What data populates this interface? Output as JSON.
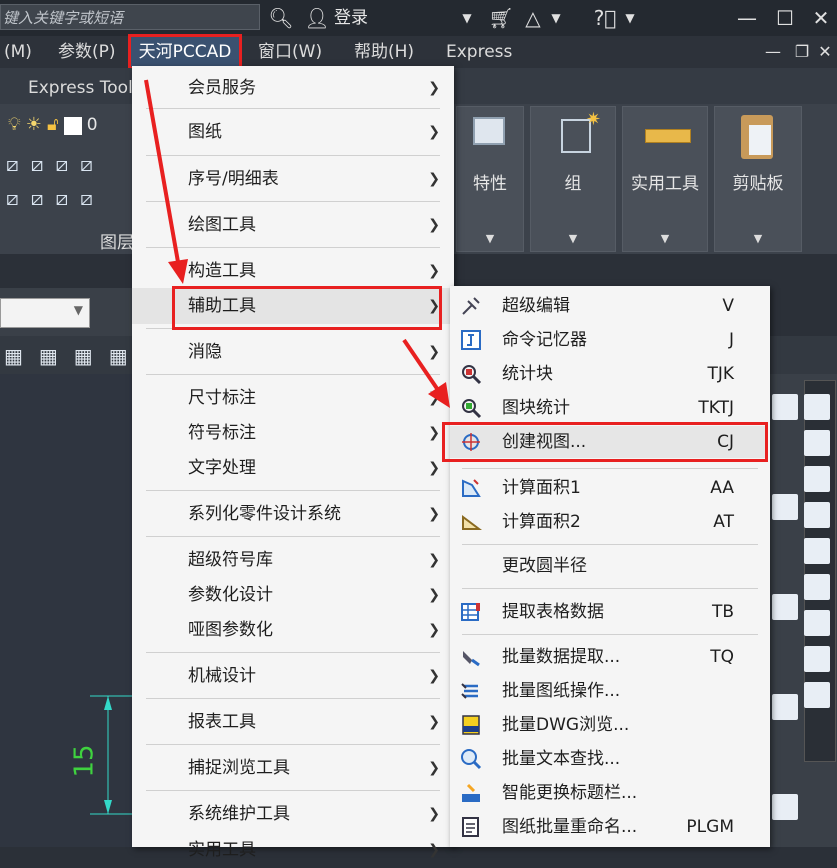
{
  "titlebar": {
    "search_placeholder": "键入关键字或短语",
    "login": "登录"
  },
  "menubar": {
    "items": [
      "(M)",
      "参数(P)",
      "天河PCCAD",
      "窗口(W)",
      "帮助(H)",
      "Express"
    ]
  },
  "ribbon": {
    "tab_express": "Express Tool",
    "layer_label": "图层",
    "layer_value": "0",
    "panels": [
      "特性",
      "组",
      "实用工具",
      "剪贴板"
    ]
  },
  "canvas": {
    "dimension": "15"
  },
  "main_menu": {
    "items": [
      {
        "label": "会员服务"
      },
      {
        "label": "图纸"
      },
      {
        "label": "序号/明细表"
      },
      {
        "label": "绘图工具"
      },
      {
        "label": "构造工具"
      },
      {
        "label": "辅助工具"
      },
      {
        "label": "消隐"
      },
      {
        "label": "尺寸标注"
      },
      {
        "label": "符号标注"
      },
      {
        "label": "文字处理"
      },
      {
        "label": "系列化零件设计系统"
      },
      {
        "label": "超级符号库"
      },
      {
        "label": "参数化设计"
      },
      {
        "label": "哑图参数化"
      },
      {
        "label": "机械设计"
      },
      {
        "label": "报表工具"
      },
      {
        "label": "捕捉浏览工具"
      },
      {
        "label": "系统维护工具"
      },
      {
        "label": "实用工具"
      }
    ]
  },
  "submenu": {
    "items": [
      {
        "label": "超级编辑",
        "key": "V"
      },
      {
        "label": "命令记忆器",
        "key": "J"
      },
      {
        "label": "统计块",
        "key": "TJK"
      },
      {
        "label": "图块统计",
        "key": "TKTJ"
      },
      {
        "label": "创建视图...",
        "key": "CJ"
      },
      {
        "label": "计算面积1",
        "key": "AA"
      },
      {
        "label": "计算面积2",
        "key": "AT"
      },
      {
        "label": "更改圆半径",
        "key": ""
      },
      {
        "label": "提取表格数据",
        "key": "TB"
      },
      {
        "label": "批量数据提取...",
        "key": "TQ"
      },
      {
        "label": "批量图纸操作...",
        "key": ""
      },
      {
        "label": "批量DWG浏览...",
        "key": ""
      },
      {
        "label": "批量文本查找...",
        "key": ""
      },
      {
        "label": "智能更换标题栏...",
        "key": ""
      },
      {
        "label": "图纸批量重命名...",
        "key": "PLGM"
      }
    ]
  },
  "colors": {
    "highlight_red": "#e82020",
    "accent_blue": "#3a5170"
  }
}
